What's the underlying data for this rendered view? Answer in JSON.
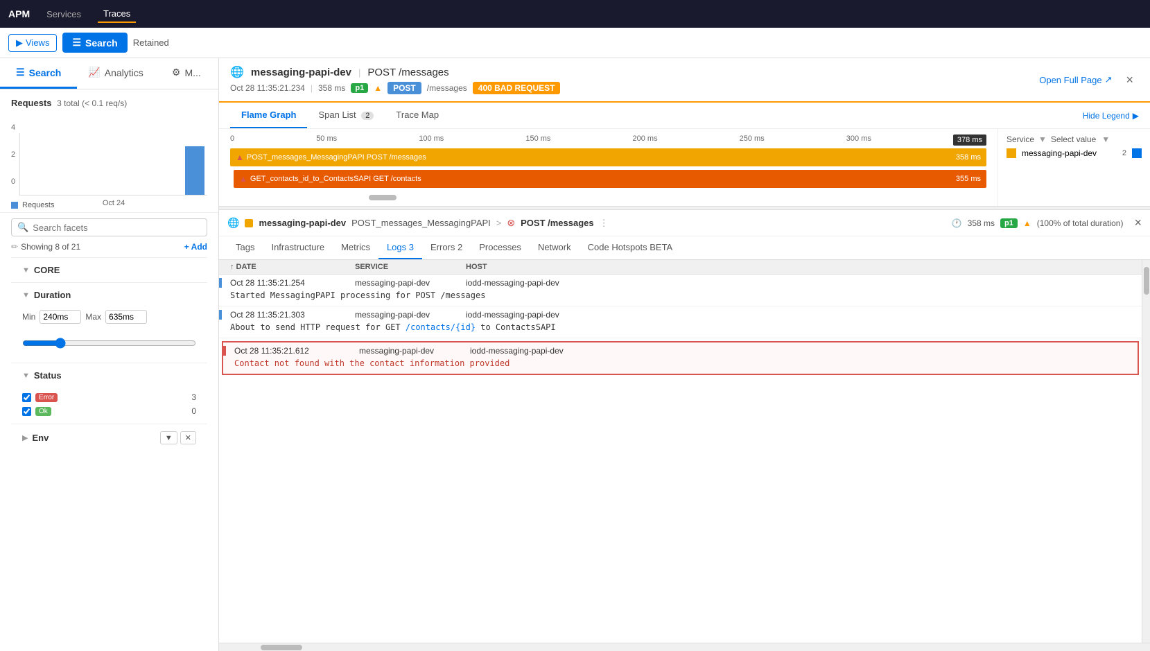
{
  "topnav": {
    "brand": "APM",
    "items": [
      "Services",
      "Traces"
    ]
  },
  "secondnav": {
    "views_label": "Views",
    "search_label": "Search",
    "retained_label": "Retained"
  },
  "sidebar_tabs": {
    "search_label": "Search",
    "analytics_label": "Analytics",
    "map_label": "M..."
  },
  "requests": {
    "title": "Requests",
    "subtitle": "3 total (< 0.1 req/s)",
    "y_labels": [
      "4",
      "2",
      "0"
    ],
    "x_label": "Oct 24",
    "legend": "Requests"
  },
  "facets": {
    "search_placeholder": "Search facets",
    "showing_text": "Showing 8 of 21",
    "add_label": "+ Add",
    "core_label": "CORE",
    "duration_label": "Duration",
    "duration_min_label": "Min",
    "duration_max_label": "Max",
    "duration_min_val": "240ms",
    "duration_max_val": "635ms",
    "status_label": "Status",
    "error_label": "Error",
    "error_count": "3",
    "ok_label": "Ok",
    "ok_count": "0",
    "env_label": "Env"
  },
  "trace_header": {
    "service": "messaging-papi-dev",
    "separator": "|",
    "endpoint": "POST /messages",
    "timestamp": "Oct 28 11:35:21.234",
    "duration": "358 ms",
    "p_badge": "p1",
    "method": "POST",
    "path": "/messages",
    "status": "400 BAD REQUEST",
    "open_full": "Open Full Page",
    "close": "×"
  },
  "flame_tabs": {
    "flame_graph": "Flame Graph",
    "span_list": "Span List",
    "span_count": "2",
    "trace_map": "Trace Map",
    "hide_legend": "Hide Legend"
  },
  "timeline": {
    "marks": [
      "0",
      "50 ms",
      "100 ms",
      "150 ms",
      "200 ms",
      "250 ms",
      "300 ms"
    ],
    "end_mark": "378 ms"
  },
  "flame_bars": [
    {
      "label": "POST_messages_MessagingPAPI POST /messages",
      "duration": "358 ms",
      "color": "#f0a500",
      "left_pct": 0,
      "width_pct": 94,
      "has_error": true
    },
    {
      "label": "GET_contacts_id_to_ContactsSAPI GET /contacts",
      "duration": "355 ms",
      "color": "#e85a00",
      "left_pct": 0.5,
      "width_pct": 93,
      "has_error": true
    }
  ],
  "legend": {
    "service_label": "Service",
    "select_value": "Select value",
    "entries": [
      {
        "name": "messaging-papi-dev",
        "count": "2",
        "color": "#f0a500"
      }
    ]
  },
  "span_detail": {
    "service": "messaging-papi-dev",
    "op_name": "POST_messages_MessagingPAPI",
    "arrow": ">",
    "endpoint": "POST /messages",
    "more_icon": "⋮",
    "duration": "358 ms",
    "p_badge": "p1",
    "pct_total": "(100% of total duration)",
    "close": "×"
  },
  "span_tabs": {
    "tabs": [
      "Tags",
      "Infrastructure",
      "Metrics",
      "Logs 3",
      "Errors 2",
      "Processes",
      "Network",
      "Code Hotspots BETA"
    ],
    "active_tab": "Logs 3"
  },
  "logs": {
    "headers": [
      "↑ DATE",
      "SERVICE",
      "HOST"
    ],
    "entries": [
      {
        "timestamp": "Oct 28 11:35:21.254",
        "service": "messaging-papi-dev",
        "host": "iodd-messaging-papi-dev",
        "message": "Started MessagingPAPI processing for POST /messages",
        "highlighted": false
      },
      {
        "timestamp": "Oct 28 11:35:21.303",
        "service": "messaging-papi-dev",
        "host": "iodd-messaging-papi-dev",
        "message": "About to send HTTP request for GET /contacts/{id} to ContactsSAPI",
        "highlighted": false
      },
      {
        "timestamp": "Oct 28 11:35:21.612",
        "service": "messaging-papi-dev",
        "host": "iodd-messaging-papi-dev",
        "message": "Contact not found with the contact information provided",
        "highlighted": true
      }
    ]
  }
}
